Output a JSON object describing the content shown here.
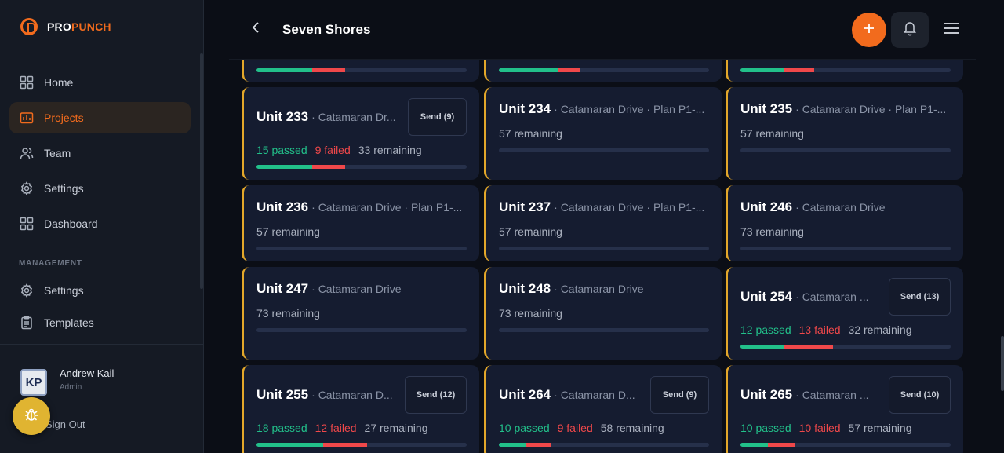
{
  "brand": {
    "pro": "PRO",
    "punch": "PUNCH"
  },
  "nav": {
    "items": [
      {
        "label": "Home",
        "icon": "grid-icon"
      },
      {
        "label": "Projects",
        "icon": "folder-chart-icon",
        "active": true
      },
      {
        "label": "Team",
        "icon": "users-icon"
      },
      {
        "label": "Settings",
        "icon": "gear-icon"
      },
      {
        "label": "Dashboard",
        "icon": "grid-icon"
      }
    ],
    "management_label": "MANAGEMENT",
    "management": [
      {
        "label": "Settings",
        "icon": "gear-icon"
      },
      {
        "label": "Templates",
        "icon": "clipboard-icon"
      }
    ]
  },
  "user": {
    "name": "Andrew Kail",
    "role": "Admin",
    "initials": "KP"
  },
  "signout_label": "Sign Out",
  "header": {
    "title": "Seven Shores"
  },
  "colors": {
    "accent": "#f26b1d",
    "passed": "#22c08a",
    "failed": "#f0484a",
    "card": "#151c30",
    "card_border": "#e3a72a",
    "bug_fab": "#e0b431"
  },
  "cards": [
    {
      "name": "",
      "sub": "",
      "total": 57,
      "passed": 15,
      "failed": 9,
      "remaining": "",
      "send": ""
    },
    {
      "name": "",
      "sub": "",
      "total": 57,
      "passed": 16,
      "failed": 6,
      "remaining": "",
      "send": ""
    },
    {
      "name": "",
      "sub": "",
      "total": 57,
      "passed": 12,
      "failed": 8,
      "remaining": "",
      "send": ""
    },
    {
      "name": "Unit 233",
      "sub": "· Catamaran Dr...",
      "total": 57,
      "passed": 15,
      "failed": 9,
      "passed_label": "15 passed",
      "failed_label": "9 failed",
      "remaining": "33 remaining",
      "send": "Send (9)"
    },
    {
      "name": "Unit 234",
      "sub": "· Catamaran Drive · Plan P1-...",
      "total": 57,
      "passed": 0,
      "failed": 0,
      "remaining": "57 remaining",
      "send": ""
    },
    {
      "name": "Unit 235",
      "sub": "· Catamaran Drive · Plan P1-...",
      "total": 57,
      "passed": 0,
      "failed": 0,
      "remaining": "57 remaining",
      "send": ""
    },
    {
      "name": "Unit 236",
      "sub": "· Catamaran Drive · Plan P1-...",
      "total": 57,
      "passed": 0,
      "failed": 0,
      "remaining": "57 remaining",
      "send": ""
    },
    {
      "name": "Unit 237",
      "sub": "· Catamaran Drive · Plan P1-...",
      "total": 57,
      "passed": 0,
      "failed": 0,
      "remaining": "57 remaining",
      "send": ""
    },
    {
      "name": "Unit 246",
      "sub": "· Catamaran Drive",
      "total": 73,
      "passed": 0,
      "failed": 0,
      "remaining": "73 remaining",
      "send": ""
    },
    {
      "name": "Unit 247",
      "sub": "· Catamaran Drive",
      "total": 73,
      "passed": 0,
      "failed": 0,
      "remaining": "73 remaining",
      "send": ""
    },
    {
      "name": "Unit 248",
      "sub": "· Catamaran Drive",
      "total": 73,
      "passed": 0,
      "failed": 0,
      "remaining": "73 remaining",
      "send": ""
    },
    {
      "name": "Unit 254",
      "sub": "· Catamaran ...",
      "total": 57,
      "passed": 12,
      "failed": 13,
      "passed_label": "12 passed",
      "failed_label": "13 failed",
      "remaining": "32 remaining",
      "send": "Send (13)"
    },
    {
      "name": "Unit 255",
      "sub": "· Catamaran D...",
      "total": 57,
      "passed": 18,
      "failed": 12,
      "passed_label": "18 passed",
      "failed_label": "12 failed",
      "remaining": "27 remaining",
      "send": "Send (12)"
    },
    {
      "name": "Unit 264",
      "sub": "· Catamaran D...",
      "total": 77,
      "passed": 10,
      "failed": 9,
      "passed_label": "10 passed",
      "failed_label": "9 failed",
      "remaining": "58 remaining",
      "send": "Send (9)"
    },
    {
      "name": "Unit 265",
      "sub": "· Catamaran ...",
      "total": 77,
      "passed": 10,
      "failed": 10,
      "passed_label": "10 passed",
      "failed_label": "10 failed",
      "remaining": "57 remaining",
      "send": "Send (10)"
    }
  ]
}
